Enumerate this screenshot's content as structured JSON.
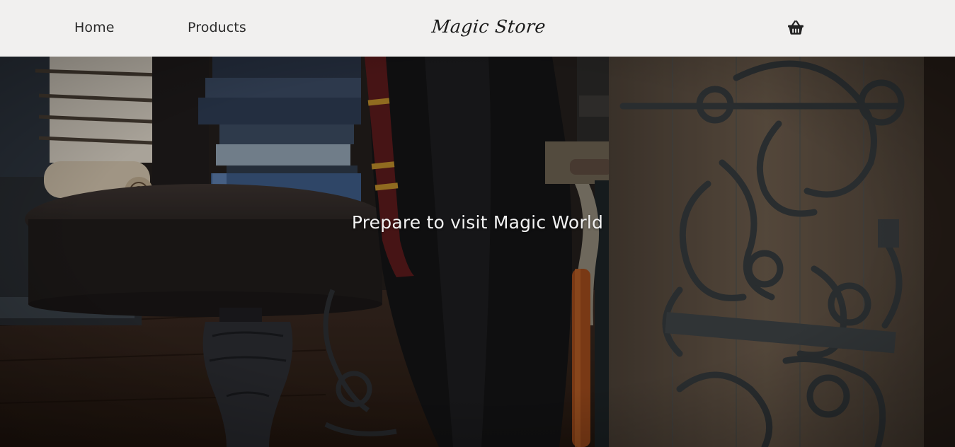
{
  "header": {
    "nav": [
      {
        "label": "Home"
      },
      {
        "label": "Products"
      }
    ],
    "logo_text": "Magic Store",
    "cart_icon": "shopping-basket-icon"
  },
  "hero": {
    "title": "Prepare to visit Magic World",
    "background": "photo-wizard-shop-interior"
  },
  "colors": {
    "header_bg": "#f1f0ef",
    "hero_text": "#f2f2f2",
    "nav_text": "#2b2b2b"
  }
}
